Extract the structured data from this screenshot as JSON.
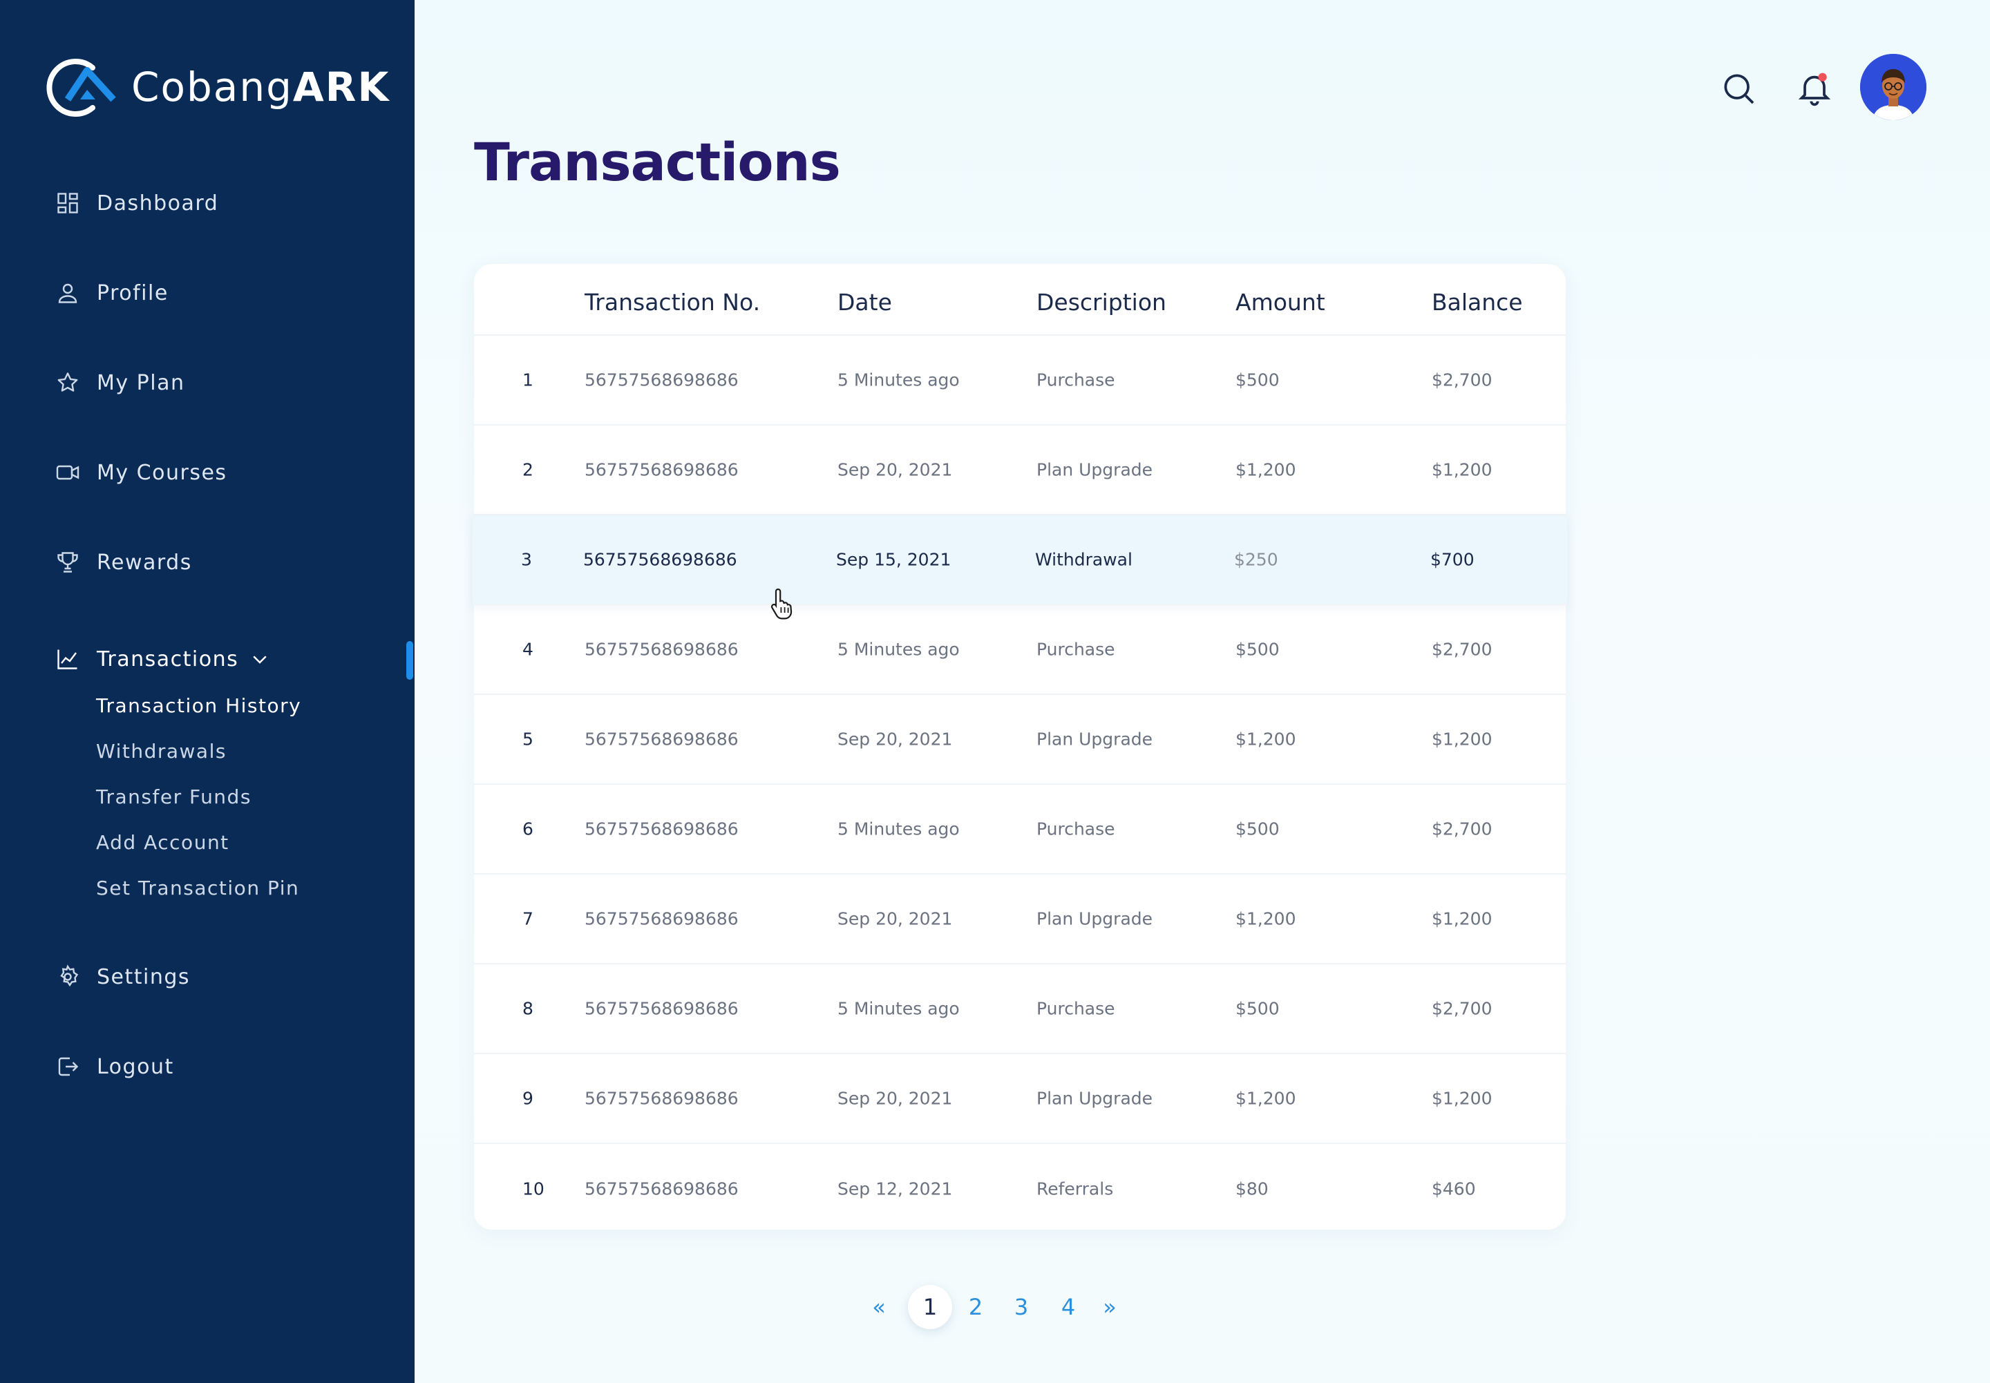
{
  "brand": {
    "name_light": "Cobang",
    "name_bold": "ARK"
  },
  "sidebar": {
    "items": [
      {
        "label": "Dashboard",
        "icon": "dashboard-icon"
      },
      {
        "label": "Profile",
        "icon": "user-icon"
      },
      {
        "label": "My Plan",
        "icon": "star-icon"
      },
      {
        "label": "My Courses",
        "icon": "video-icon"
      },
      {
        "label": "Rewards",
        "icon": "trophy-icon"
      },
      {
        "label": "Transactions",
        "icon": "chart-icon",
        "expanded": true
      },
      {
        "label": "Settings",
        "icon": "gear-icon"
      },
      {
        "label": "Logout",
        "icon": "logout-icon"
      }
    ],
    "sub_items": [
      "Transaction History",
      "Withdrawals",
      "Transfer Funds",
      "Add Account",
      "Set Transaction Pin"
    ],
    "active_sub": "Transaction History"
  },
  "header": {
    "title": "Transactions",
    "icons": [
      "search-icon",
      "bell-icon"
    ],
    "notification_dot_color": "#f0525b"
  },
  "table": {
    "columns": [
      "Transaction No.",
      "Date",
      "Description",
      "Amount",
      "Balance"
    ],
    "rows": [
      {
        "index": "1",
        "txn": "56757568698686",
        "date": "5 Minutes ago",
        "desc": "Purchase",
        "amount": "$500",
        "balance": "$2,700"
      },
      {
        "index": "2",
        "txn": "56757568698686",
        "date": "Sep 20, 2021",
        "desc": "Plan Upgrade",
        "amount": "$1,200",
        "balance": "$1,200"
      },
      {
        "index": "3",
        "txn": "56757568698686",
        "date": "Sep 15, 2021",
        "desc": "Withdrawal",
        "amount": "$250",
        "balance": "$700"
      },
      {
        "index": "4",
        "txn": "56757568698686",
        "date": "5 Minutes ago",
        "desc": "Purchase",
        "amount": "$500",
        "balance": "$2,700"
      },
      {
        "index": "5",
        "txn": "56757568698686",
        "date": "Sep 20, 2021",
        "desc": "Plan Upgrade",
        "amount": "$1,200",
        "balance": "$1,200"
      },
      {
        "index": "6",
        "txn": "56757568698686",
        "date": "5 Minutes ago",
        "desc": "Purchase",
        "amount": "$500",
        "balance": "$2,700"
      },
      {
        "index": "7",
        "txn": "56757568698686",
        "date": "Sep 20, 2021",
        "desc": "Plan Upgrade",
        "amount": "$1,200",
        "balance": "$1,200"
      },
      {
        "index": "8",
        "txn": "56757568698686",
        "date": "5 Minutes ago",
        "desc": "Purchase",
        "amount": "$500",
        "balance": "$2,700"
      },
      {
        "index": "9",
        "txn": "56757568698686",
        "date": "Sep 20, 2021",
        "desc": "Plan Upgrade",
        "amount": "$1,200",
        "balance": "$1,200"
      },
      {
        "index": "10",
        "txn": "56757568698686",
        "date": "Sep 12, 2021",
        "desc": "Referrals",
        "amount": "$80",
        "balance": "$460"
      }
    ],
    "highlighted_row": 3
  },
  "pagination": {
    "prev": "«",
    "pages": [
      "1",
      "2",
      "3",
      "4"
    ],
    "current": "1",
    "next": "»"
  },
  "colors": {
    "sidebar": "#0b2b57",
    "title": "#271a6b",
    "accent": "#2b8fdc",
    "highlight_row": "#ecf7fd"
  }
}
